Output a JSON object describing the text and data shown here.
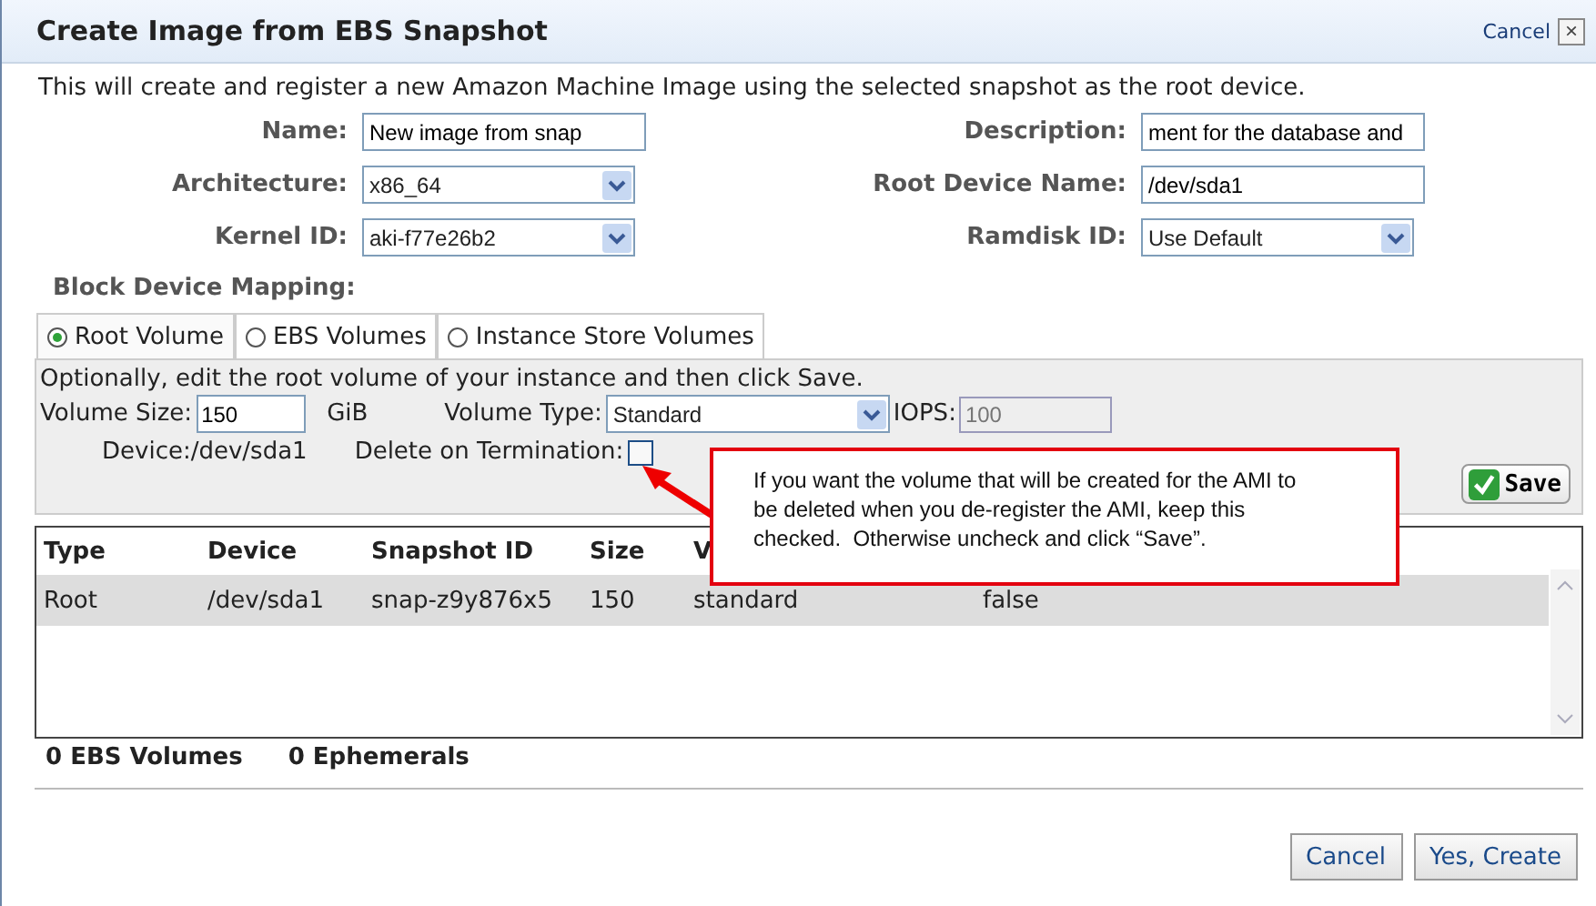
{
  "dialog": {
    "title": "Create Image from EBS Snapshot",
    "cancel_link": "Cancel",
    "close_glyph": "×"
  },
  "intro": "This will create and register a new Amazon Machine Image using the selected snapshot as the root device.",
  "fields": [
    {
      "label": "Name:",
      "kind": "text",
      "value": "New image from snap"
    },
    {
      "label": "Description:",
      "kind": "text",
      "value": "ment for the database and"
    },
    {
      "label": "Architecture:",
      "kind": "select",
      "value": "x86_64"
    },
    {
      "label": "Root Device Name:",
      "kind": "text",
      "value": "/dev/sda1"
    },
    {
      "label": "Kernel ID:",
      "kind": "select",
      "value": "aki-f77e26b2"
    },
    {
      "label": "Ramdisk ID:",
      "kind": "select",
      "value": "Use Default"
    }
  ],
  "block_device_mapping": {
    "label": "Block Device Mapping:",
    "tabs": [
      {
        "label": "Root Volume",
        "selected": true
      },
      {
        "label": "EBS Volumes",
        "selected": false
      },
      {
        "label": "Instance Store Volumes",
        "selected": false
      }
    ],
    "hint": "Optionally, edit the root volume of your instance and then click Save.",
    "volume_size": {
      "label": "Volume Size:",
      "value": "150",
      "unit": "GiB"
    },
    "volume_type": {
      "label": "Volume Type:",
      "value": "Standard"
    },
    "iops": {
      "label": "IOPS:",
      "placeholder": "100",
      "disabled": true
    },
    "device": "Device:/dev/sda1",
    "delete_on_termination": {
      "label": "Delete on Termination:",
      "checked": false
    },
    "save_button": "Save"
  },
  "callout": "If you want the volume that will be created for the AMI to be deleted when you de-register the AMI, keep this checked.  Otherwise uncheck and click “Save”.",
  "table": {
    "columns": [
      "Type",
      "Device",
      "Snapshot ID",
      "Size",
      "V"
    ],
    "rows": [
      {
        "cells": [
          "Root",
          "/dev/sda1",
          "snap-z9y876x5",
          "150",
          "standard",
          "false"
        ],
        "selected": true
      }
    ]
  },
  "summary": [
    "0 EBS Volumes",
    "0 Ephemerals"
  ],
  "buttons": [
    "Cancel",
    "Yes, Create"
  ]
}
